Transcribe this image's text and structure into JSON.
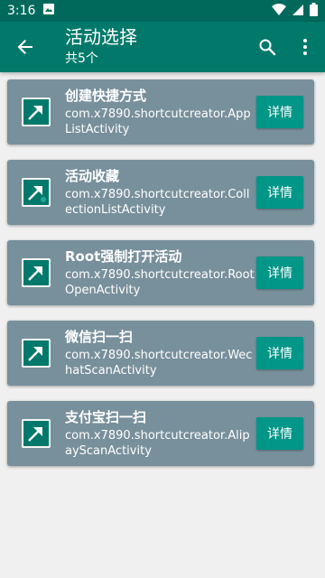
{
  "status_bar": {
    "time": "3:16",
    "icons": [
      "image-icon",
      "wifi-icon",
      "signal-icon",
      "battery-icon"
    ]
  },
  "app_bar": {
    "title": "活动选择",
    "subtitle": "共5个",
    "icons": [
      "back-arrow-icon",
      "search-icon",
      "more-vert-icon"
    ]
  },
  "colors": {
    "status_bar": "#00695c",
    "app_bar": "#00796b",
    "card": "#78909c",
    "button": "#009688",
    "background": "#f0f0f0"
  },
  "activities": [
    {
      "name": "创建快捷方式",
      "package": "com.x7890.shortcutcreator.AppListActivity",
      "button": "详情",
      "icon": "shortcut-arrow-icon"
    },
    {
      "name": "活动收藏",
      "package": "com.x7890.shortcutcreator.CollectionListActivity",
      "button": "详情",
      "icon": "shortcut-arrow-icon"
    },
    {
      "name": "Root强制打开活动",
      "package": "com.x7890.shortcutcreator.RootOpenActivity",
      "button": "详情",
      "icon": "shortcut-arrow-icon"
    },
    {
      "name": "微信扫一扫",
      "package": "com.x7890.shortcutcreator.WechatScanActivity",
      "button": "详情",
      "icon": "shortcut-arrow-icon"
    },
    {
      "name": "支付宝扫一扫",
      "package": "com.x7890.shortcutcreator.AlipayScanActivity",
      "button": "详情",
      "icon": "shortcut-arrow-icon"
    }
  ]
}
